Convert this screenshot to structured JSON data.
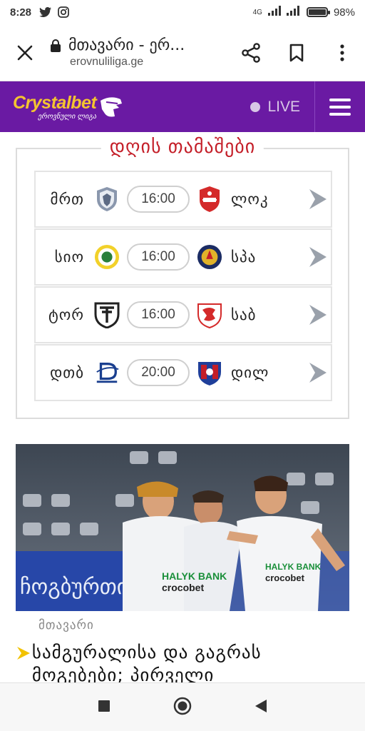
{
  "status": {
    "time": "8:28",
    "network": "4G",
    "battery": "98%"
  },
  "browser": {
    "title": "მთავარი - ერ...",
    "url": "erovnuliliga.ge"
  },
  "header": {
    "brand": "Crystalbet",
    "subtitle": "ეროვნული ლიგა",
    "live_label": "LIVE"
  },
  "games": {
    "title": "დღის თამაშები",
    "items": [
      {
        "home": "მრთ",
        "time": "16:00",
        "away": "ლოკ"
      },
      {
        "home": "სიო",
        "time": "16:00",
        "away": "სპა"
      },
      {
        "home": "ტორ",
        "time": "16:00",
        "away": "საბ"
      },
      {
        "home": "დთბ",
        "time": "20:00",
        "away": "დილ"
      }
    ]
  },
  "news": {
    "image_text": {
      "sponsor": "crocobet",
      "sponsor2": "HALYK BANK",
      "banner": "ჩოგბურთი"
    },
    "category": "მთავარი",
    "title": "სამგურალისა და გაგრას მოგებები; პირველი"
  },
  "colors": {
    "header_bg": "#6a1aa3",
    "accent_red": "#c41e28",
    "brand_yellow": "#f4c430"
  }
}
